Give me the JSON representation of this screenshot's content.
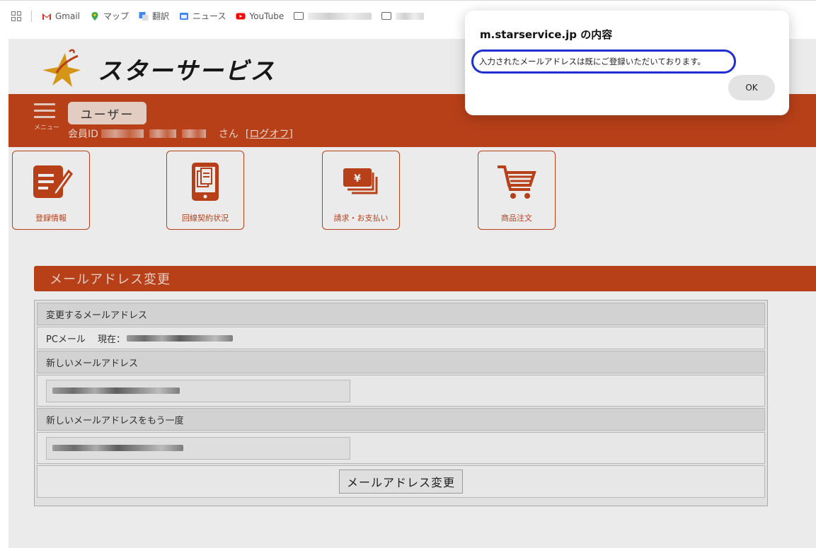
{
  "bookmarks": {
    "items": [
      {
        "label": "Gmail",
        "icon": "gmail-icon"
      },
      {
        "label": "マップ",
        "icon": "maps-icon"
      },
      {
        "label": "翻訳",
        "icon": "translate-icon"
      },
      {
        "label": "ニュース",
        "icon": "news-icon"
      },
      {
        "label": "YouTube",
        "icon": "youtube-icon"
      }
    ]
  },
  "site": {
    "logo_text": "スターサービス",
    "menu_label": "メニュー",
    "user_button": "ユーザー",
    "member_id_label": "会員ID",
    "san": "さん",
    "logout": "[ログオフ]",
    "accent_color": "#c8461c"
  },
  "tiles": [
    {
      "label": "登録情報",
      "icon": "edit-document-icon"
    },
    {
      "label": "回線契約状況",
      "icon": "contract-document-icon"
    },
    {
      "label": "請求・お支払い",
      "icon": "yen-bills-icon"
    },
    {
      "label": "商品注文",
      "icon": "shopping-cart-icon"
    }
  ],
  "section": {
    "title": "メールアドレス変更"
  },
  "form": {
    "change_label": "変更するメールアドレス",
    "pc_mail_label": "PCメール　 現在：",
    "new_label": "新しいメールアドレス",
    "confirm_label": "新しいメールアドレスをもう一度",
    "submit_label": "メールアドレス変更"
  },
  "dialog": {
    "title": "m.starservice.jp の内容",
    "message": "入力されたメールアドレスは既にご登録いただいております。",
    "ok_label": "OK",
    "highlight_color": "#1f2fd1"
  }
}
